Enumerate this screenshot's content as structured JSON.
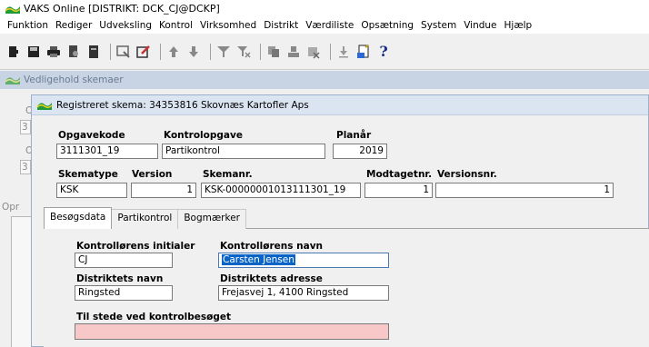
{
  "app": {
    "title": "VAKS Online [DISTRIKT: DCK_CJ@DCKP]"
  },
  "menu": [
    "Funktion",
    "Rediger",
    "Udveksling",
    "Kontrol",
    "Virksomhed",
    "Distrikt",
    "Værdiliste",
    "Opsætning",
    "System",
    "Vindue",
    "Hjælp"
  ],
  "toolbar": {
    "icons": [
      "exit-icon",
      "save-icon",
      "print-icon",
      "preview-icon",
      "print-setup-icon",
      "search-icon",
      "edit-icon",
      "arrow-up-icon",
      "arrow-down-icon",
      "filter-icon",
      "clear-filter-icon",
      "copy-icon",
      "stamp-icon",
      "delete-icon",
      "download-icon",
      "notes-icon",
      "help-icon"
    ],
    "help_label": "?"
  },
  "bg_window": {
    "title": "Vedligehold skemaer",
    "ghost_letters": [
      "O",
      "3",
      "O",
      "3"
    ],
    "ghost_label": "Opr"
  },
  "dialog": {
    "title": "Registreret skema: 34353816 Skovnæs Kartofler Aps",
    "fields": {
      "opgavekode": {
        "label": "Opgavekode",
        "value": "3111301_19"
      },
      "kontrolopgave": {
        "label": "Kontrolopgave",
        "value": "Partikontrol"
      },
      "planaar": {
        "label": "Planår",
        "value": "2019"
      },
      "skematype": {
        "label": "Skematype",
        "value": "KSK"
      },
      "version": {
        "label": "Version",
        "value": "1"
      },
      "skemanr": {
        "label": "Skemanr.",
        "value": "KSK-00000001013111301_19"
      },
      "modtagetnr": {
        "label": "Modtagetnr.",
        "value": "1"
      },
      "versionsnr": {
        "label": "Versionsnr.",
        "value": "1"
      }
    },
    "tabs": [
      "Besøgsdata",
      "Partikontrol",
      "Bogmærker"
    ],
    "active_tab": "Besøgsdata",
    "visit": {
      "initials": {
        "label": "Kontrollørens initialer",
        "value": "CJ"
      },
      "name": {
        "label": "Kontrollørens navn",
        "value": "Carsten Jensen"
      },
      "district_name": {
        "label": "Distriktets navn",
        "value": "Ringsted"
      },
      "district_address": {
        "label": "Distriktets adresse",
        "value": "Frejasvej 1, 4100 Ringsted"
      },
      "present": {
        "label": "Til stede ved kontrolbesøget",
        "value": ""
      }
    }
  },
  "colors": {
    "selection": "#0a64c8",
    "required_field": "#f8c8c8",
    "dialog_title_bg": "#dbe5f2"
  }
}
